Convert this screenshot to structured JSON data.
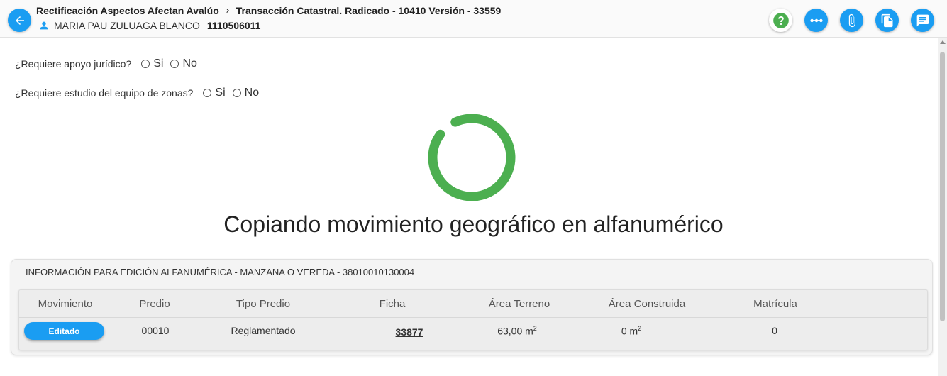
{
  "header": {
    "breadcrumb_1": "Rectificación Aspectos Afectan Avalúo",
    "breadcrumb_2": "Transacción Catastral. Radicado - 10410 Versión - 33559",
    "user_name": "MARIA PAU ZULUAGA BLANCO",
    "user_id": "1110506011"
  },
  "actions": [
    "help-icon",
    "timeline-icon",
    "attachment-icon",
    "documents-icon",
    "comments-icon"
  ],
  "questions": {
    "q1": {
      "label": "¿Requiere apoyo jurídico?",
      "yes": "Si",
      "no": "No"
    },
    "q2": {
      "label": "¿Requiere estudio del equipo de zonas?",
      "yes": "Si",
      "no": "No"
    }
  },
  "loading": {
    "message": "Copiando movimiento geográfico en alfanumérico",
    "progress_fraction": 0.92
  },
  "panel": {
    "title": "INFORMACIÓN PARA EDICIÓN ALFANUMÉRICA - MANZANA O VEREDA - 38010010130004",
    "columns": [
      "Movimiento",
      "Predio",
      "Tipo Predio",
      "Ficha",
      "Área Terreno",
      "Área Construida",
      "Matrícula"
    ],
    "row": {
      "movimiento": "Editado",
      "predio": "00010",
      "tipo_predio": "Reglamentado",
      "ficha": "33877",
      "area_terreno": "63,00 m",
      "area_construida": "0 m",
      "area_unit_sup": "2",
      "matricula": "0"
    }
  },
  "colors": {
    "primary": "#1a9df2",
    "spinner": "#4caf50",
    "help": "#4caf50"
  }
}
